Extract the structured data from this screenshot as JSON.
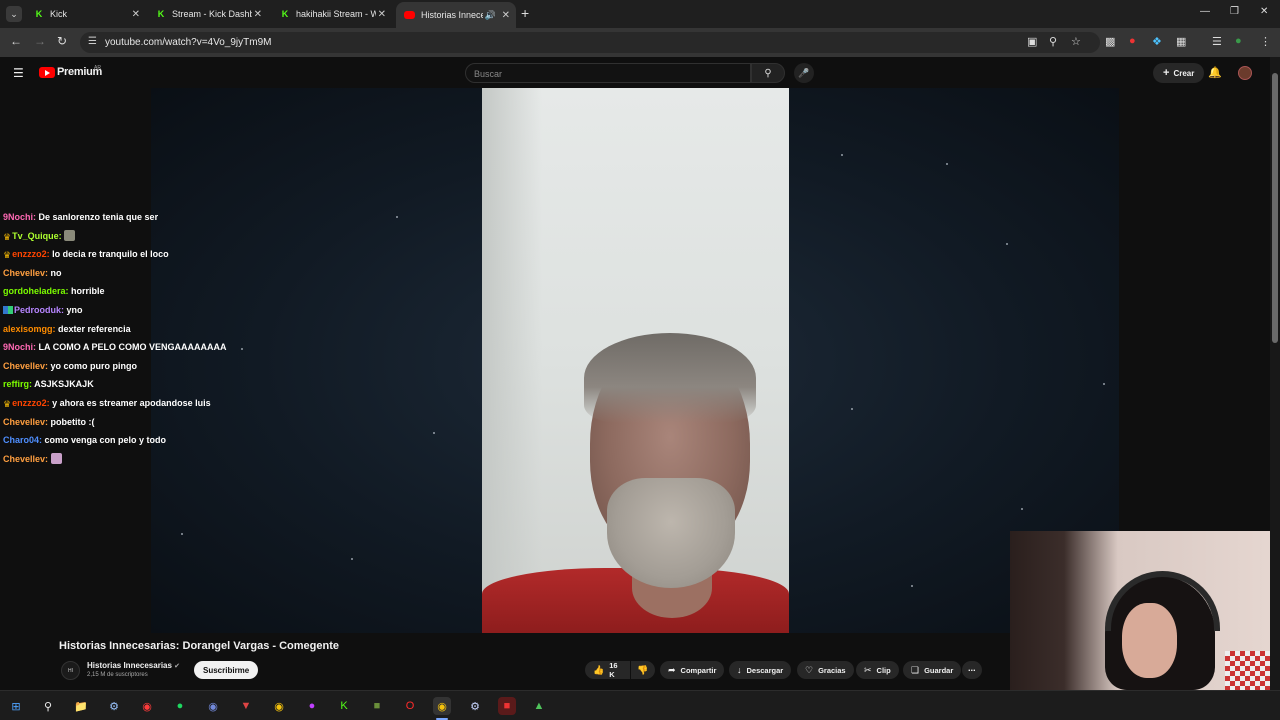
{
  "browser": {
    "tabs": [
      {
        "title": "Kick",
        "favicon": "kick-icon"
      },
      {
        "title": "Stream - Kick Dashbo",
        "favicon": "kick-icon"
      },
      {
        "title": "hakihakii Stream - W",
        "favicon": "kick-icon"
      },
      {
        "title": "Historias Innece",
        "favicon": "youtube-icon",
        "active": true,
        "audio": true
      }
    ],
    "url": "youtube.com/watch?v=4Vo_9jyTm9M"
  },
  "youtube": {
    "logo_text": "Premium",
    "country_code": "AR",
    "search_placeholder": "Buscar",
    "create_label": "Crear"
  },
  "chat": [
    {
      "user": "9Nochi:",
      "color": "#ff69b4",
      "text": "De sanlorenzo tenia que ser",
      "badge": ""
    },
    {
      "user": "Tv_Quique:",
      "color": "#adff2f",
      "text": "",
      "badge": "crown",
      "emote": true
    },
    {
      "user": "enzzzo2:",
      "color": "#ff4500",
      "text": "lo decia re tranquilo el loco",
      "badge": "crown"
    },
    {
      "user": "Chevellev:",
      "color": "#ff9f40",
      "text": "no",
      "badge": ""
    },
    {
      "user": "gordoheladera:",
      "color": "#7cfc00",
      "text": "horrible",
      "badge": ""
    },
    {
      "user": "Pedrooduk:",
      "color": "#b685ff",
      "text": "yno",
      "badge": "grid"
    },
    {
      "user": "alexisomgg:",
      "color": "#ff8c00",
      "text": "dexter referencia",
      "badge": ""
    },
    {
      "user": "9Nochi:",
      "color": "#ff69b4",
      "text": "LA COMO A PELO COMO VENGAAAAAAAA",
      "badge": ""
    },
    {
      "user": "Chevellev:",
      "color": "#ff9f40",
      "text": "yo como puro pingo",
      "badge": ""
    },
    {
      "user": "reffirg:",
      "color": "#7cfc00",
      "text": "ASJKSJKAJK",
      "badge": ""
    },
    {
      "user": "enzzzo2:",
      "color": "#ff4500",
      "text": "y ahora es streamer apodandose luis",
      "badge": "crown"
    },
    {
      "user": "Chevellev:",
      "color": "#ff9f40",
      "text": "pobetito :(",
      "badge": ""
    },
    {
      "user": "Charo04:",
      "color": "#4f8fff",
      "text": "como venga con pelo y todo",
      "badge": ""
    },
    {
      "user": "Chevellev:",
      "color": "#ff9f40",
      "text": "",
      "badge": "",
      "emote": true
    }
  ],
  "video": {
    "title": "Historias Innecesarias: Dorangel Vargas - Comegente",
    "channel": "Historias Innecesarias",
    "subscribers": "2,15 M de suscriptores",
    "subscribe_label": "Suscribirme",
    "likes": "16 K",
    "actions": {
      "share": "Compartir",
      "download": "Descargar",
      "thanks": "Gracias",
      "clip": "Clip",
      "save": "Guardar"
    }
  }
}
